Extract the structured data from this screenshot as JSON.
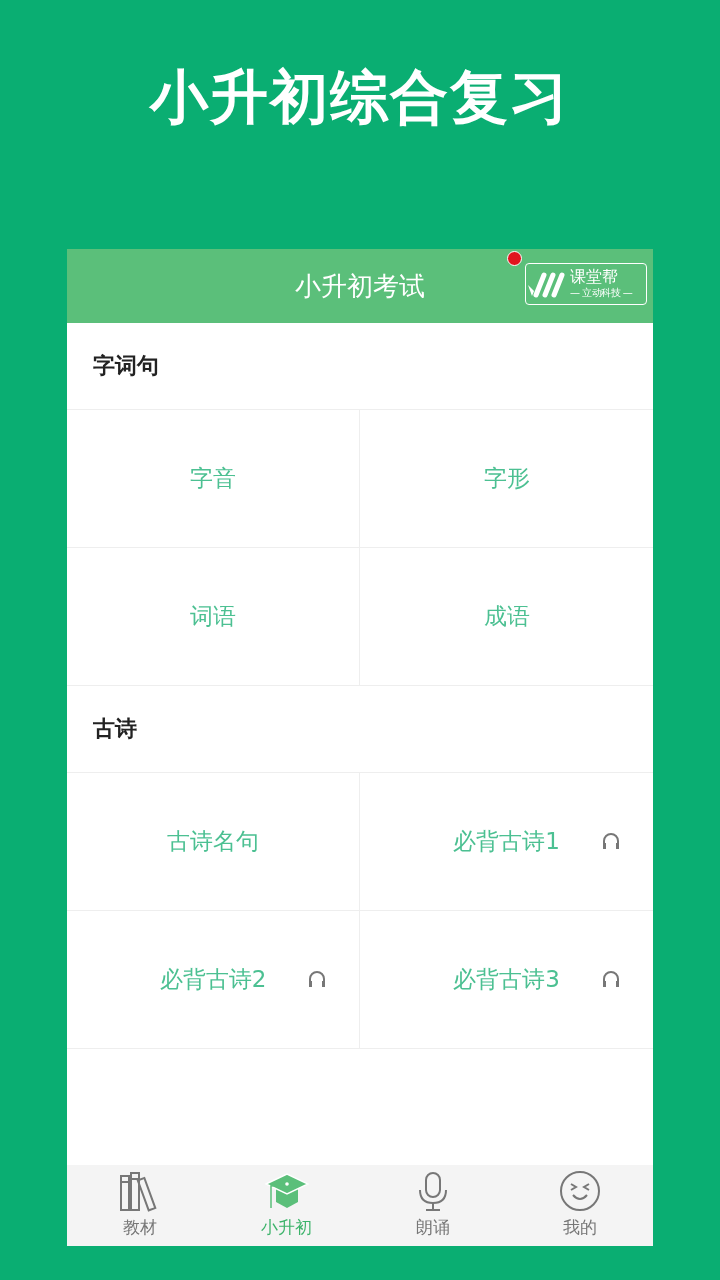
{
  "page_title": "小升初综合复习",
  "header": {
    "title": "小升初考试",
    "badge_dot": true,
    "logo": {
      "name": "课堂帮",
      "tagline": "— 立动科技 —"
    }
  },
  "sections": [
    {
      "title": "字词句",
      "items": [
        {
          "label": "字音",
          "audio": false
        },
        {
          "label": "字形",
          "audio": false
        },
        {
          "label": "词语",
          "audio": false
        },
        {
          "label": "成语",
          "audio": false
        }
      ]
    },
    {
      "title": "古诗",
      "items": [
        {
          "label": "古诗名句",
          "audio": false
        },
        {
          "label": "必背古诗1",
          "audio": true
        },
        {
          "label": "必背古诗2",
          "audio": true
        },
        {
          "label": "必背古诗3",
          "audio": true
        }
      ]
    }
  ],
  "tab_bar": [
    {
      "label": "教材",
      "kind": "books",
      "selected": false
    },
    {
      "label": "小升初",
      "kind": "cap",
      "selected": true
    },
    {
      "label": "朗诵",
      "kind": "mic",
      "selected": false
    },
    {
      "label": "我的",
      "kind": "smile",
      "selected": false
    }
  ]
}
